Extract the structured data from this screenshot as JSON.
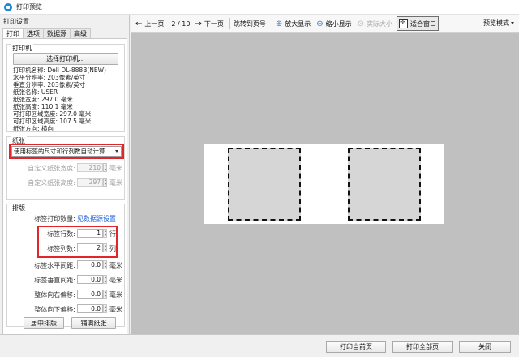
{
  "window": {
    "title": "打印预览"
  },
  "sidebar": {
    "heading": "打印设置",
    "tabs": [
      "打印",
      "选项",
      "数据源",
      "高级"
    ],
    "printer_group": {
      "title": "打印机",
      "select_button": "选择打印机...",
      "info": [
        "打印机名称: Deli DL-888B(NEW)",
        "水平分辨率: 203像素/英寸",
        "垂直分辨率: 203像素/英寸",
        "纸张名称: USER",
        "纸张宽度: 297.0 毫米",
        "纸张高度: 110.1 毫米",
        "可打印区域宽度: 297.0 毫米",
        "可打印区域高度: 107.5 毫米",
        "纸张方向: 横向"
      ]
    },
    "paper_group": {
      "title": "纸张",
      "mode_selected": "使用标签的尺寸和行列数自动计算",
      "custom_width_label": "自定义纸张宽度:",
      "custom_width_value": "210",
      "custom_height_label": "自定义纸张高度:",
      "custom_height_value": "297",
      "unit": "毫米"
    },
    "layout_group": {
      "title": "排版",
      "print_count_label": "标签打印数量:",
      "print_count_link": "见数据源设置",
      "rows_label": "标签行数:",
      "rows_value": "1",
      "rows_unit": "行",
      "cols_label": "标签列数:",
      "cols_value": "2",
      "cols_unit": "列",
      "h_gap_label": "标签水平间距:",
      "h_gap_value": "0.0",
      "v_gap_label": "标签垂直间距:",
      "v_gap_value": "0.0",
      "right_offset_label": "整体向右偏移:",
      "right_offset_value": "0.0",
      "down_offset_label": "整体向下偏移:",
      "down_offset_value": "0.0",
      "unit": "毫米",
      "center_button": "居中排版",
      "fill_button": "铺满纸张"
    }
  },
  "toolbar": {
    "prev": "上一页",
    "page_current": "2",
    "page_total": "10",
    "page_sep": "/",
    "next": "下一页",
    "goto": "跳转到页号",
    "zoom_in": "放大显示",
    "zoom_out": "缩小显示",
    "actual_size": "实际大小",
    "fit_window": "适合窗口",
    "preview_mode": "预览模式"
  },
  "footer": {
    "print_current": "打印当前页",
    "print_all": "打印全部页",
    "close": "关闭"
  },
  "colors": {
    "highlight_border": "#e0262a",
    "link": "#1a5fd6",
    "canvas": "#c0c0c0"
  }
}
